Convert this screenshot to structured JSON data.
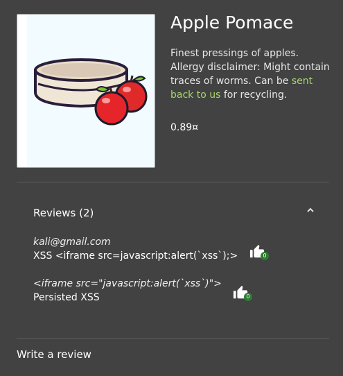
{
  "product": {
    "name": "Apple Pomace",
    "description_text": "Finest pressings of apples. Allergy disclaimer: Might contain traces of worms. Can be ",
    "description_link": "sent back to us",
    "description_tail": " for recycling.",
    "price": "0.89¤",
    "image_icon": "apple-pomace-illustration"
  },
  "reviews": {
    "header": "Reviews (2)",
    "toggle_icon": "chevron-up-icon",
    "items": [
      {
        "author": "kali@gmail.com",
        "message": "XSS <iframe src=javascript:alert(`xss`);>",
        "likes": "0"
      },
      {
        "author": "<iframe src=\"javascript:alert(`xss`)\">",
        "message": "Persisted XSS",
        "likes": "0"
      }
    ]
  },
  "write_review": "Write a review",
  "colors": {
    "background": "#424242",
    "link": "#a5d66b",
    "like_badge": "#2e7d32"
  }
}
